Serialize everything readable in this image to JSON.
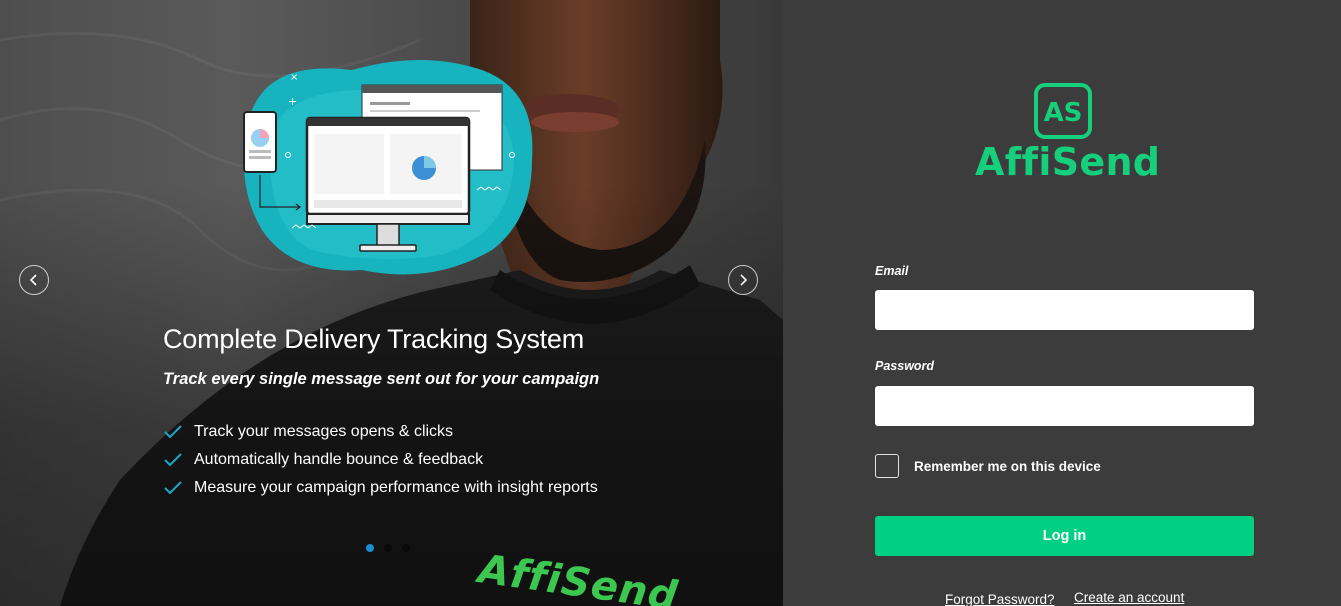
{
  "brand": {
    "name": "AffiSend",
    "logo_mark": "AS",
    "accent_color": "#00d084",
    "logo_color": "#16cf7c"
  },
  "carousel": {
    "prev_icon": "chevron-left-icon",
    "next_icon": "chevron-right-icon",
    "active_slide": 1,
    "slide_count": 3,
    "slide": {
      "title": "Complete Delivery Tracking System",
      "subtitle": "Track every single message sent out for your campaign",
      "features": [
        "Track your messages opens & clicks",
        "Automatically handle bounce & feedback",
        "Measure your campaign performance with insight reports"
      ],
      "shirt_text": "AffiSend"
    }
  },
  "login_form": {
    "email_label": "Email",
    "email_value": "",
    "password_label": "Password",
    "password_value": "",
    "remember_label": "Remember me on this device",
    "remember_checked": false,
    "login_button": "Log in",
    "forgot_link": "Forgot Password?",
    "create_link": "Create an account"
  }
}
